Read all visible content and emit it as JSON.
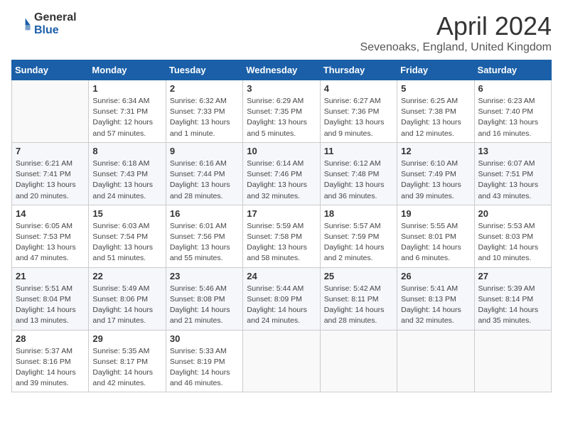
{
  "header": {
    "logo": {
      "general": "General",
      "blue": "Blue"
    },
    "title": "April 2024",
    "location": "Sevenoaks, England, United Kingdom"
  },
  "days_of_week": [
    "Sunday",
    "Monday",
    "Tuesday",
    "Wednesday",
    "Thursday",
    "Friday",
    "Saturday"
  ],
  "weeks": [
    [
      {
        "day": "",
        "info": ""
      },
      {
        "day": "1",
        "info": "Sunrise: 6:34 AM\nSunset: 7:31 PM\nDaylight: 12 hours\nand 57 minutes."
      },
      {
        "day": "2",
        "info": "Sunrise: 6:32 AM\nSunset: 7:33 PM\nDaylight: 13 hours\nand 1 minute."
      },
      {
        "day": "3",
        "info": "Sunrise: 6:29 AM\nSunset: 7:35 PM\nDaylight: 13 hours\nand 5 minutes."
      },
      {
        "day": "4",
        "info": "Sunrise: 6:27 AM\nSunset: 7:36 PM\nDaylight: 13 hours\nand 9 minutes."
      },
      {
        "day": "5",
        "info": "Sunrise: 6:25 AM\nSunset: 7:38 PM\nDaylight: 13 hours\nand 12 minutes."
      },
      {
        "day": "6",
        "info": "Sunrise: 6:23 AM\nSunset: 7:40 PM\nDaylight: 13 hours\nand 16 minutes."
      }
    ],
    [
      {
        "day": "7",
        "info": "Sunrise: 6:21 AM\nSunset: 7:41 PM\nDaylight: 13 hours\nand 20 minutes."
      },
      {
        "day": "8",
        "info": "Sunrise: 6:18 AM\nSunset: 7:43 PM\nDaylight: 13 hours\nand 24 minutes."
      },
      {
        "day": "9",
        "info": "Sunrise: 6:16 AM\nSunset: 7:44 PM\nDaylight: 13 hours\nand 28 minutes."
      },
      {
        "day": "10",
        "info": "Sunrise: 6:14 AM\nSunset: 7:46 PM\nDaylight: 13 hours\nand 32 minutes."
      },
      {
        "day": "11",
        "info": "Sunrise: 6:12 AM\nSunset: 7:48 PM\nDaylight: 13 hours\nand 36 minutes."
      },
      {
        "day": "12",
        "info": "Sunrise: 6:10 AM\nSunset: 7:49 PM\nDaylight: 13 hours\nand 39 minutes."
      },
      {
        "day": "13",
        "info": "Sunrise: 6:07 AM\nSunset: 7:51 PM\nDaylight: 13 hours\nand 43 minutes."
      }
    ],
    [
      {
        "day": "14",
        "info": "Sunrise: 6:05 AM\nSunset: 7:53 PM\nDaylight: 13 hours\nand 47 minutes."
      },
      {
        "day": "15",
        "info": "Sunrise: 6:03 AM\nSunset: 7:54 PM\nDaylight: 13 hours\nand 51 minutes."
      },
      {
        "day": "16",
        "info": "Sunrise: 6:01 AM\nSunset: 7:56 PM\nDaylight: 13 hours\nand 55 minutes."
      },
      {
        "day": "17",
        "info": "Sunrise: 5:59 AM\nSunset: 7:58 PM\nDaylight: 13 hours\nand 58 minutes."
      },
      {
        "day": "18",
        "info": "Sunrise: 5:57 AM\nSunset: 7:59 PM\nDaylight: 14 hours\nand 2 minutes."
      },
      {
        "day": "19",
        "info": "Sunrise: 5:55 AM\nSunset: 8:01 PM\nDaylight: 14 hours\nand 6 minutes."
      },
      {
        "day": "20",
        "info": "Sunrise: 5:53 AM\nSunset: 8:03 PM\nDaylight: 14 hours\nand 10 minutes."
      }
    ],
    [
      {
        "day": "21",
        "info": "Sunrise: 5:51 AM\nSunset: 8:04 PM\nDaylight: 14 hours\nand 13 minutes."
      },
      {
        "day": "22",
        "info": "Sunrise: 5:49 AM\nSunset: 8:06 PM\nDaylight: 14 hours\nand 17 minutes."
      },
      {
        "day": "23",
        "info": "Sunrise: 5:46 AM\nSunset: 8:08 PM\nDaylight: 14 hours\nand 21 minutes."
      },
      {
        "day": "24",
        "info": "Sunrise: 5:44 AM\nSunset: 8:09 PM\nDaylight: 14 hours\nand 24 minutes."
      },
      {
        "day": "25",
        "info": "Sunrise: 5:42 AM\nSunset: 8:11 PM\nDaylight: 14 hours\nand 28 minutes."
      },
      {
        "day": "26",
        "info": "Sunrise: 5:41 AM\nSunset: 8:13 PM\nDaylight: 14 hours\nand 32 minutes."
      },
      {
        "day": "27",
        "info": "Sunrise: 5:39 AM\nSunset: 8:14 PM\nDaylight: 14 hours\nand 35 minutes."
      }
    ],
    [
      {
        "day": "28",
        "info": "Sunrise: 5:37 AM\nSunset: 8:16 PM\nDaylight: 14 hours\nand 39 minutes."
      },
      {
        "day": "29",
        "info": "Sunrise: 5:35 AM\nSunset: 8:17 PM\nDaylight: 14 hours\nand 42 minutes."
      },
      {
        "day": "30",
        "info": "Sunrise: 5:33 AM\nSunset: 8:19 PM\nDaylight: 14 hours\nand 46 minutes."
      },
      {
        "day": "",
        "info": ""
      },
      {
        "day": "",
        "info": ""
      },
      {
        "day": "",
        "info": ""
      },
      {
        "day": "",
        "info": ""
      }
    ]
  ]
}
